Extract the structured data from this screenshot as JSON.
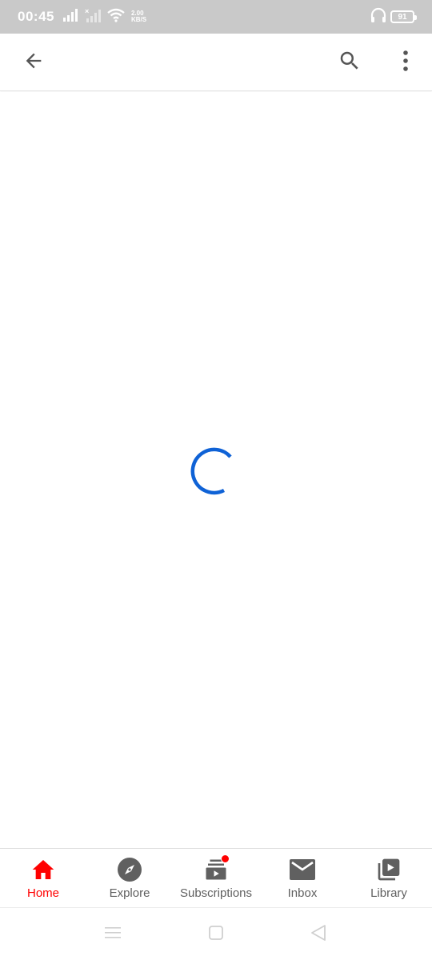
{
  "status_bar": {
    "time": "00:45",
    "net_speed_value": "2.00",
    "net_speed_unit": "KB/S",
    "battery": "91",
    "icons": [
      "signal-icon",
      "signal-no-service-icon",
      "wifi-icon",
      "headphones-icon",
      "battery-icon"
    ]
  },
  "app_bar": {
    "icons": [
      "back-arrow-icon",
      "search-icon",
      "more-vert-icon"
    ]
  },
  "content": {
    "state": "loading",
    "spinner_color": "#0f62d6"
  },
  "bottom_nav": {
    "active_color": "#ff0000",
    "items": [
      {
        "label": "Home",
        "icon": "home-icon",
        "active": true
      },
      {
        "label": "Explore",
        "icon": "explore-compass-icon",
        "active": false
      },
      {
        "label": "Subscriptions",
        "icon": "subscriptions-icon",
        "active": false,
        "badge": true
      },
      {
        "label": "Inbox",
        "icon": "inbox-mail-icon",
        "active": false
      },
      {
        "label": "Library",
        "icon": "library-icon",
        "active": false
      }
    ]
  },
  "system_nav": {
    "icons": [
      "menu-icon",
      "home-square-icon",
      "back-triangle-icon"
    ]
  }
}
